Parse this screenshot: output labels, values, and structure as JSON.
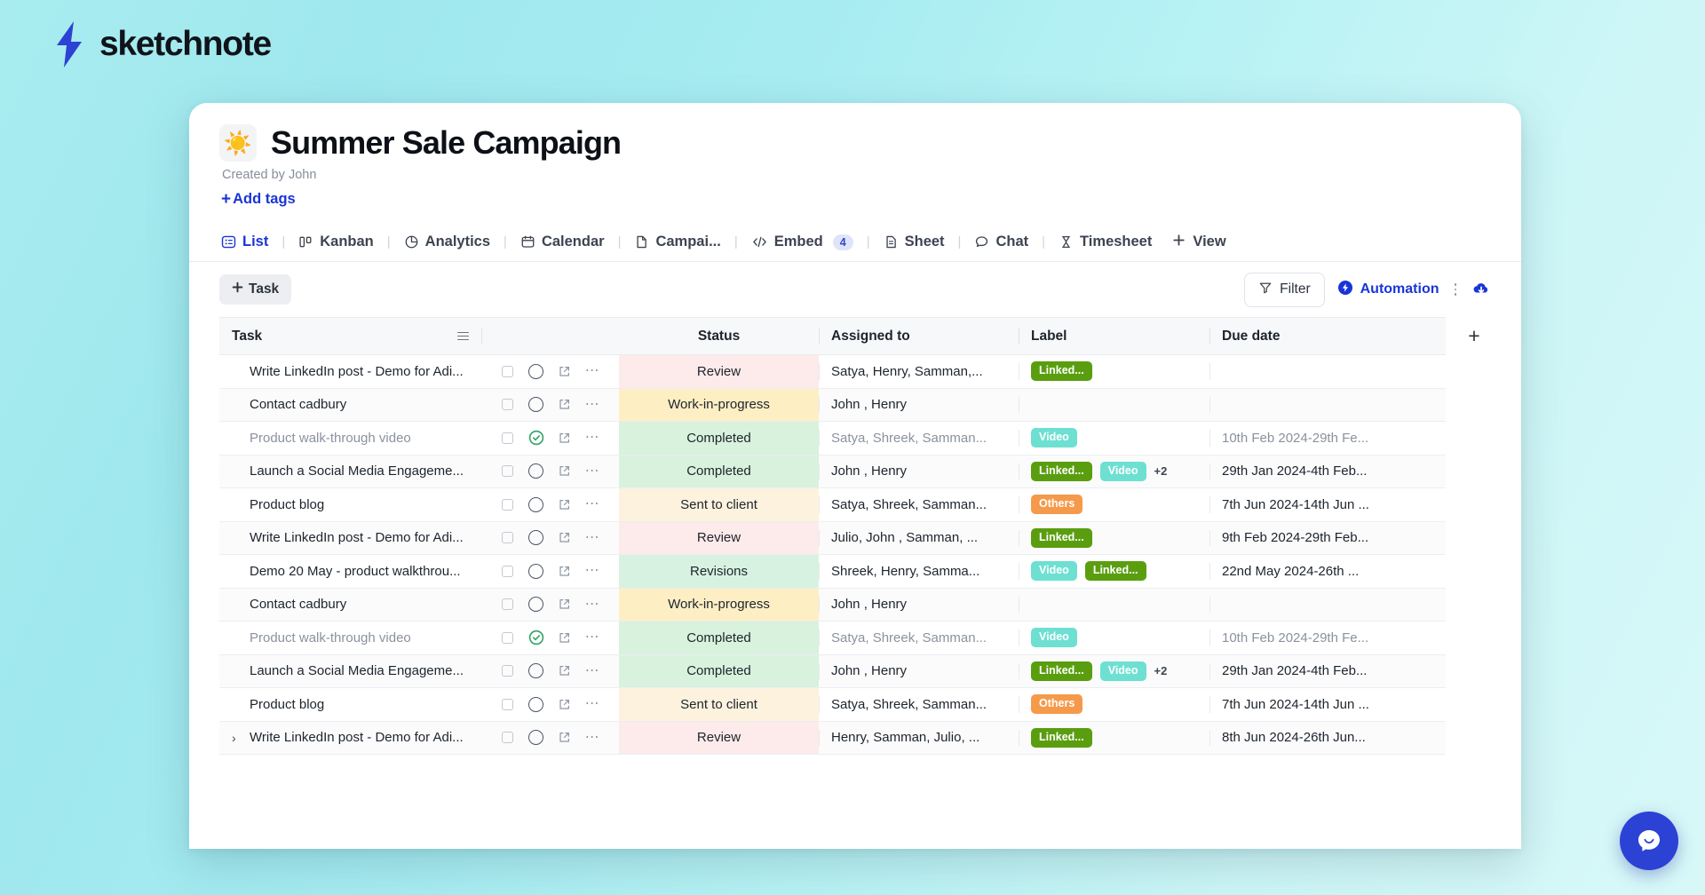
{
  "brand": {
    "name": "sketchnote",
    "logo_icon": "lightning-bolt-icon",
    "logo_color": "#2c42d4"
  },
  "document": {
    "emoji": "☀️",
    "title": "Summer Sale Campaign",
    "created_by": "Created by John",
    "add_tags_label": "Add tags"
  },
  "tabs": [
    {
      "label": "List",
      "icon": "list-icon",
      "active": true,
      "badge": null
    },
    {
      "label": "Kanban",
      "icon": "kanban-icon",
      "active": false,
      "badge": null
    },
    {
      "label": "Analytics",
      "icon": "pie-chart-icon",
      "active": false,
      "badge": null
    },
    {
      "label": "Calendar",
      "icon": "calendar-icon",
      "active": false,
      "badge": null
    },
    {
      "label": "Campai...",
      "icon": "document-icon",
      "active": false,
      "badge": null
    },
    {
      "label": "Embed",
      "icon": "code-icon",
      "active": false,
      "badge": "4"
    },
    {
      "label": "Sheet",
      "icon": "sheet-icon",
      "active": false,
      "badge": null
    },
    {
      "label": "Chat",
      "icon": "chat-icon",
      "active": false,
      "badge": null
    },
    {
      "label": "Timesheet",
      "icon": "hourglass-icon",
      "active": false,
      "badge": null
    }
  ],
  "tab_add": {
    "label": "View",
    "icon": "plus-icon"
  },
  "toolbar": {
    "add_task_label": "Task",
    "add_task_icon": "plus-icon",
    "filter_label": "Filter",
    "filter_icon": "funnel-icon",
    "automation_label": "Automation",
    "automation_icon": "bolt-circle-icon",
    "more_icon": "vertical-dots-icon",
    "download_icon": "download-circle-icon",
    "accent_color": "#1a34d8"
  },
  "table": {
    "columns": [
      "Task",
      "Status",
      "Assigned to",
      "Label",
      "Due date"
    ],
    "add_column_icon": "plus-icon",
    "rows": [
      {
        "task": "Write LinkedIn post - Demo for Adi...",
        "expandable": false,
        "done": false,
        "status": "Review",
        "status_class": "st-review",
        "assigned": "Satya, Henry, Samman,...",
        "labels": [
          {
            "text": "Linked...",
            "type": "chip-linked"
          }
        ],
        "more": "",
        "date": ""
      },
      {
        "task": "Contact cadbury",
        "expandable": false,
        "done": false,
        "status": "Work-in-progress",
        "status_class": "st-wip",
        "assigned": "John , Henry",
        "labels": [],
        "more": "",
        "date": ""
      },
      {
        "task": "Product walk-through video",
        "expandable": false,
        "done": true,
        "status": "Completed",
        "status_class": "st-completed",
        "assigned": "Satya, Shreek, Samman...",
        "labels": [
          {
            "text": "Video",
            "type": "chip-video"
          }
        ],
        "more": "",
        "date": "10th Feb 2024-29th Fe..."
      },
      {
        "task": "Launch a Social Media Engageme...",
        "expandable": false,
        "done": false,
        "status": "Completed",
        "status_class": "st-completed",
        "assigned": "John , Henry",
        "labels": [
          {
            "text": "Linked...",
            "type": "chip-linked"
          },
          {
            "text": "Video",
            "type": "chip-video"
          }
        ],
        "more": "+2",
        "date": "29th Jan 2024-4th Feb..."
      },
      {
        "task": "Product blog",
        "expandable": false,
        "done": false,
        "status": "Sent to client",
        "status_class": "st-sent",
        "assigned": "Satya, Shreek, Samman...",
        "labels": [
          {
            "text": "Others",
            "type": "chip-others"
          }
        ],
        "more": "",
        "date": "7th Jun 2024-14th Jun ..."
      },
      {
        "task": "Write LinkedIn post - Demo for Adi...",
        "expandable": false,
        "done": false,
        "status": "Review",
        "status_class": "st-review",
        "assigned": "Julio, John , Samman, ...",
        "labels": [
          {
            "text": "Linked...",
            "type": "chip-linked"
          }
        ],
        "more": "",
        "date": "9th Feb 2024-29th Feb..."
      },
      {
        "task": "Demo 20 May - product walkthrou...",
        "expandable": false,
        "done": false,
        "status": "Revisions",
        "status_class": "st-revisions",
        "assigned": "Shreek, Henry, Samma...",
        "labels": [
          {
            "text": "Video",
            "type": "chip-video"
          },
          {
            "text": "Linked...",
            "type": "chip-linked"
          }
        ],
        "more": "",
        "date": "22nd May 2024-26th ..."
      },
      {
        "task": "Contact cadbury",
        "expandable": false,
        "done": false,
        "status": "Work-in-progress",
        "status_class": "st-wip",
        "assigned": "John , Henry",
        "labels": [],
        "more": "",
        "date": ""
      },
      {
        "task": "Product walk-through video",
        "expandable": false,
        "done": true,
        "status": "Completed",
        "status_class": "st-completed",
        "assigned": "Satya, Shreek, Samman...",
        "labels": [
          {
            "text": "Video",
            "type": "chip-video"
          }
        ],
        "more": "",
        "date": "10th Feb 2024-29th Fe..."
      },
      {
        "task": "Launch a Social Media Engageme...",
        "expandable": false,
        "done": false,
        "status": "Completed",
        "status_class": "st-completed",
        "assigned": "John , Henry",
        "labels": [
          {
            "text": "Linked...",
            "type": "chip-linked"
          },
          {
            "text": "Video",
            "type": "chip-video"
          }
        ],
        "more": "+2",
        "date": "29th Jan 2024-4th Feb..."
      },
      {
        "task": "Product blog",
        "expandable": false,
        "done": false,
        "status": "Sent to client",
        "status_class": "st-sent",
        "assigned": "Satya, Shreek, Samman...",
        "labels": [
          {
            "text": "Others",
            "type": "chip-others"
          }
        ],
        "more": "",
        "date": "7th Jun 2024-14th Jun ..."
      },
      {
        "task": "Write LinkedIn post - Demo for Adi...",
        "expandable": true,
        "done": false,
        "status": "Review",
        "status_class": "st-review",
        "assigned": "Henry, Samman, Julio, ...",
        "labels": [
          {
            "text": "Linked...",
            "type": "chip-linked"
          }
        ],
        "more": "",
        "date": "8th Jun 2024-26th Jun..."
      }
    ]
  },
  "chat_widget": {
    "icon": "chat-bubble-icon",
    "color": "#2c42d4"
  }
}
